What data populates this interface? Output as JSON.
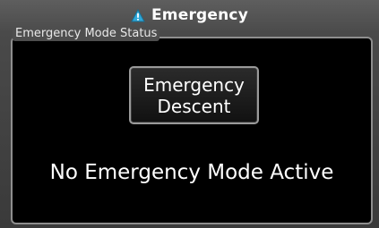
{
  "window": {
    "title": "Emergency",
    "title_icon": "warning-triangle-icon",
    "title_icon_colors": {
      "fill": "#2fa7d8",
      "mark": "#ffffff",
      "outline": "#1a6f93"
    }
  },
  "status_panel": {
    "label": "Emergency Mode Status",
    "descent_button_label": "Emergency\nDescent",
    "status_message": "No Emergency Mode Active"
  },
  "colors": {
    "background": "#4a4a4a",
    "panel": "#000000",
    "panel_border": "#8e8e8e",
    "text": "#ffffff"
  }
}
